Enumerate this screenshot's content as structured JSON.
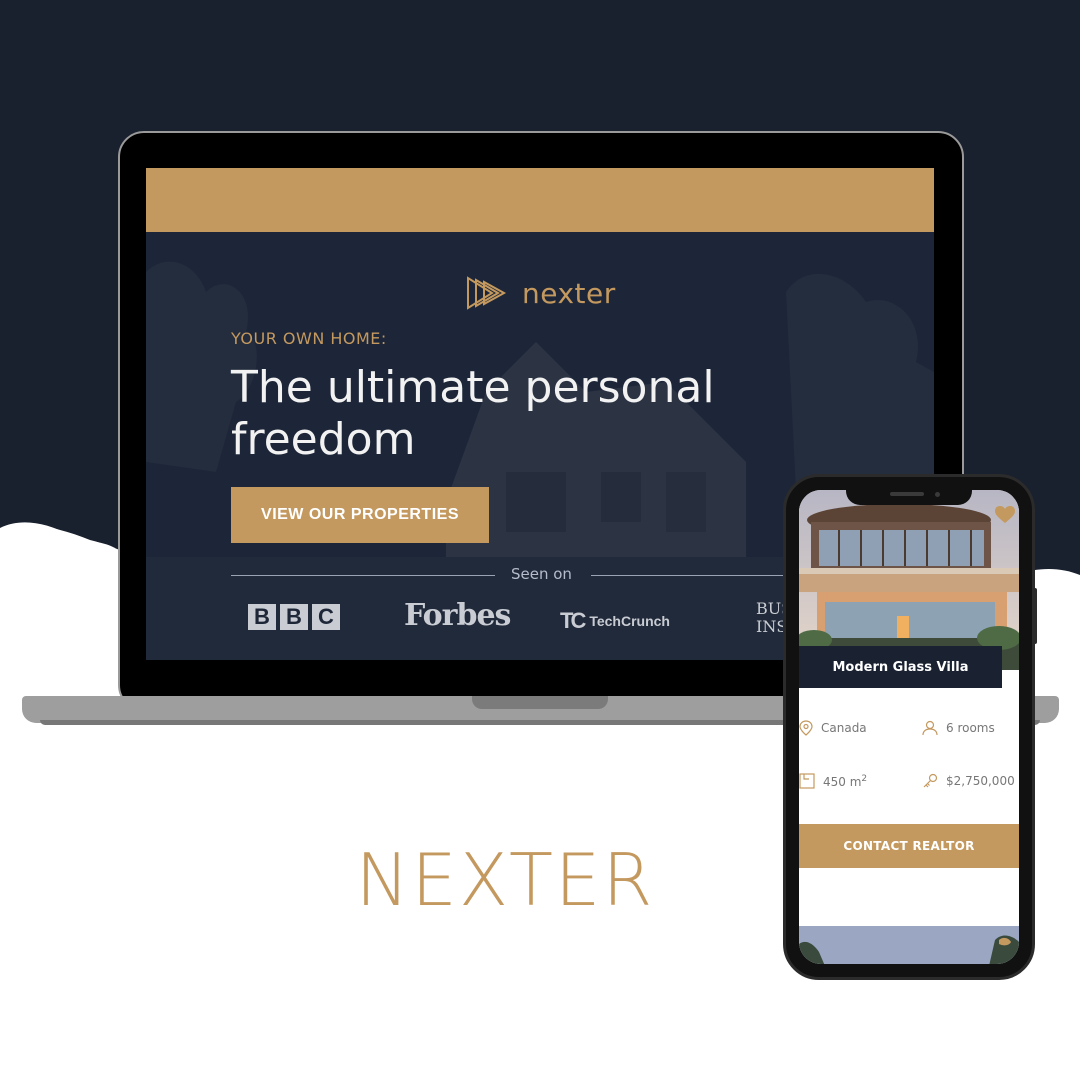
{
  "colors": {
    "navy": "#19202e",
    "gold": "#c4995f",
    "white": "#ffffff"
  },
  "laptop": {
    "logo_text": "nexter",
    "eyebrow": "YOUR OWN HOME:",
    "headline_line1": "The ultimate personal",
    "headline_line2": "freedom",
    "cta_label": "VIEW OUR PROPERTIES",
    "seen_on": "Seen on",
    "brands": [
      "BBC",
      "Forbes",
      "TechCrunch",
      "Business Insider"
    ],
    "tc_mark": "TC",
    "bi_line1": "BUS",
    "bi_line2": "INS"
  },
  "phone": {
    "property_title": "Modern Glass Villa",
    "location": "Canada",
    "rooms": "6 rooms",
    "area": "450 m",
    "area_sup": "2",
    "price": "$2,750,000",
    "contact_label": "CONTACT REALTOR",
    "icons": [
      "map-pin-icon",
      "user-icon",
      "area-icon",
      "key-icon",
      "heart-icon"
    ]
  },
  "brand_name": "NEXTER"
}
